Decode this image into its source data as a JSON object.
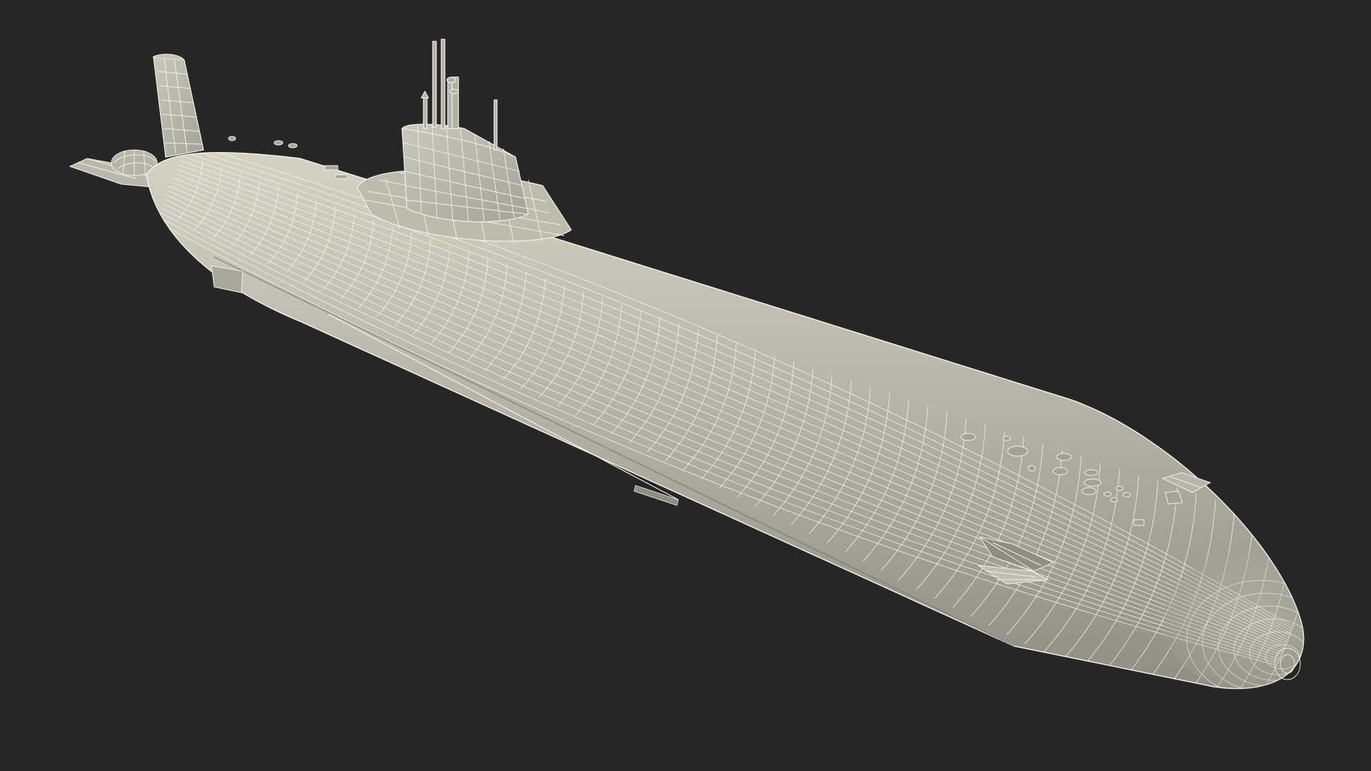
{
  "scene": {
    "subject": "submarine-wireframe-render",
    "colors": {
      "background": "#262626",
      "hull_fill": "#b4b3a6",
      "hull_shadow": "#8c8b80",
      "hull_highlight": "#d6d5c8",
      "wire": "#f2f1e8",
      "deck_detail": "#7d7c72"
    }
  }
}
